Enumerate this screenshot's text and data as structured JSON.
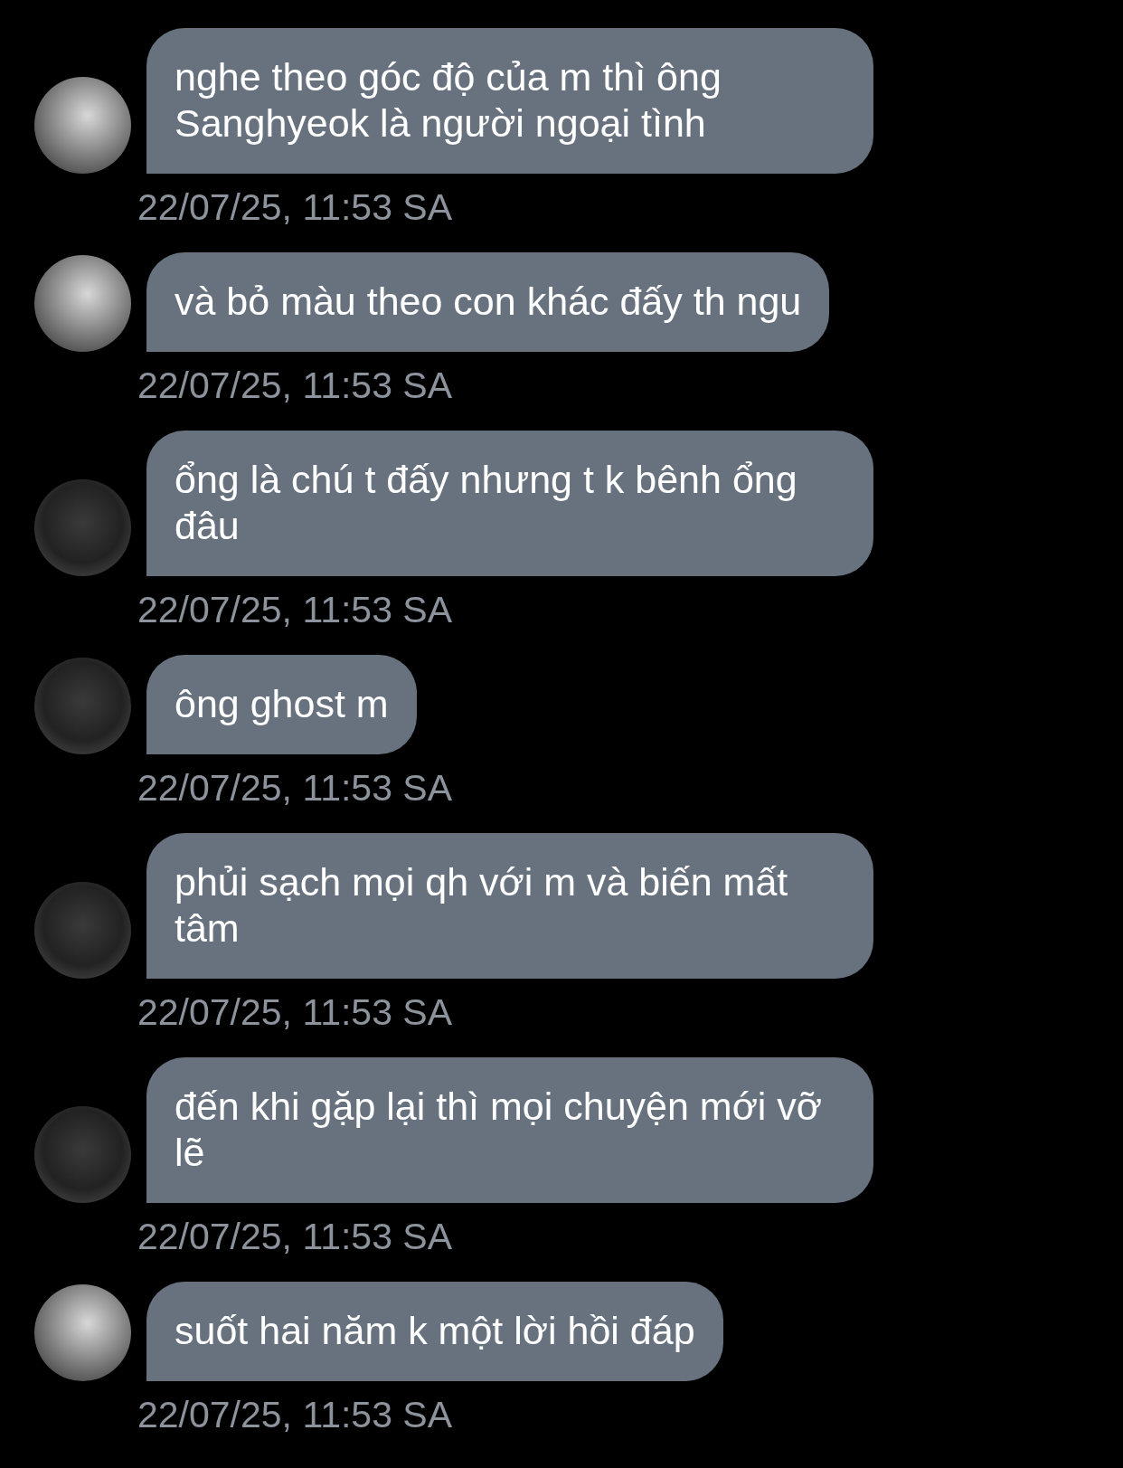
{
  "messages": [
    {
      "kind": "light",
      "lines": [
        "nghe theo góc độ của m thì ông",
        "Sanghyeok là người ngoại tình"
      ],
      "time": "22/07/25, 11:53 SA"
    },
    {
      "kind": "light",
      "lines": [
        "và bỏ màu theo con khác đấy th ngu"
      ],
      "time": "22/07/25, 11:53 SA"
    },
    {
      "kind": "dark",
      "lines": [
        "ổng là chú t đấy nhưng t k bênh ổng",
        "đâu"
      ],
      "time": "22/07/25, 11:53 SA"
    },
    {
      "kind": "dark",
      "lines": [
        "ông ghost m"
      ],
      "time": "22/07/25, 11:53 SA"
    },
    {
      "kind": "dark",
      "lines": [
        "phủi sạch mọi qh với m và biến mất",
        "tâm"
      ],
      "time": "22/07/25, 11:53 SA"
    },
    {
      "kind": "dark",
      "lines": [
        "đến khi gặp lại thì mọi chuyện mới vỡ",
        "lẽ"
      ],
      "time": "22/07/25, 11:53 SA"
    },
    {
      "kind": "light",
      "lines": [
        "suốt hai năm k một lời hồi đáp"
      ],
      "time": "22/07/25, 11:53 SA"
    }
  ]
}
